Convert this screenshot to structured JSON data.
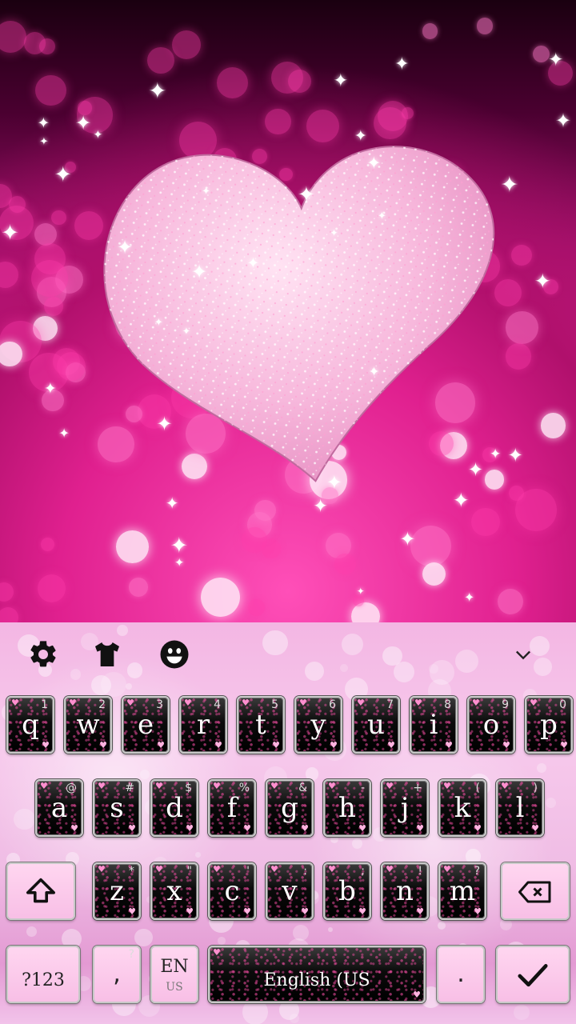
{
  "wallpaper": {
    "colors": {
      "bg_dark": "#1a0010",
      "bg_pink": "#e3279a",
      "heart": "#f7b8dc"
    }
  },
  "toolbar": {
    "settings_icon": "gear-icon",
    "theme_icon": "tshirt-icon",
    "emoji_icon": "emoji-icon",
    "collapse_icon": "chevron-down-icon"
  },
  "keys": {
    "row1": [
      {
        "label": "q",
        "hint": "1"
      },
      {
        "label": "w",
        "hint": "2"
      },
      {
        "label": "e",
        "hint": "3"
      },
      {
        "label": "r",
        "hint": "4"
      },
      {
        "label": "t",
        "hint": "5"
      },
      {
        "label": "y",
        "hint": "6"
      },
      {
        "label": "u",
        "hint": "7"
      },
      {
        "label": "i",
        "hint": "8"
      },
      {
        "label": "o",
        "hint": "9"
      },
      {
        "label": "p",
        "hint": "0"
      }
    ],
    "row2": [
      {
        "label": "a",
        "hint": "@"
      },
      {
        "label": "s",
        "hint": "#"
      },
      {
        "label": "d",
        "hint": "$"
      },
      {
        "label": "f",
        "hint": "%"
      },
      {
        "label": "g",
        "hint": "&"
      },
      {
        "label": "h",
        "hint": "-"
      },
      {
        "label": "j",
        "hint": "+"
      },
      {
        "label": "k",
        "hint": "("
      },
      {
        "label": "l",
        "hint": ")"
      }
    ],
    "row3": [
      {
        "label": "z",
        "hint": "*"
      },
      {
        "label": "x",
        "hint": "\""
      },
      {
        "label": "c",
        "hint": "'"
      },
      {
        "label": "v",
        "hint": ":"
      },
      {
        "label": "b",
        "hint": ";"
      },
      {
        "label": "n",
        "hint": "!"
      },
      {
        "label": "m",
        "hint": "?"
      }
    ],
    "symbols": "?123",
    "comma": ",",
    "comma_hint": "?",
    "lang_top": "EN",
    "lang_bottom": "US",
    "space": "English (US",
    "period": ".",
    "shift_icon": "shift-icon",
    "backspace_icon": "backspace-icon",
    "enter_icon": "checkmark-icon"
  }
}
